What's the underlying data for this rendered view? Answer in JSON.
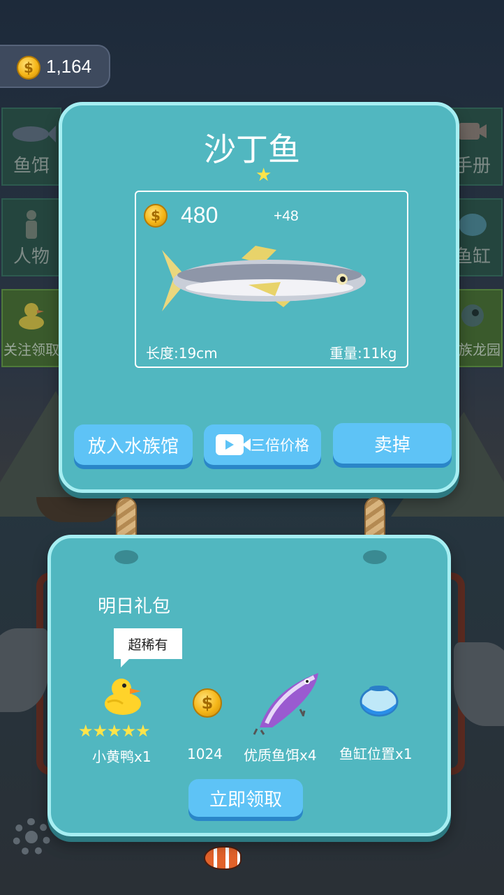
{
  "wallet": {
    "coins": "1,164"
  },
  "side_menu": {
    "left": [
      {
        "label": "鱼饵",
        "icon": "tuna-icon"
      },
      {
        "label": "人物",
        "icon": "person-icon"
      },
      {
        "label": "关注领取",
        "icon": "duck-icon"
      }
    ],
    "right": [
      {
        "label": "手册",
        "icon": "video-camera-icon"
      },
      {
        "label": "鱼缸",
        "icon": "fishbowl-icon"
      },
      {
        "label": "水族龙园",
        "icon": "fish-eye-icon"
      }
    ]
  },
  "catch": {
    "fish_name": "沙丁鱼",
    "rarity_stars": 1,
    "price": "480",
    "bonus": "+48",
    "length": "长度:19cm",
    "weight": "重量:11kg",
    "buttons": {
      "aquarium": "放入水族馆",
      "triple": "三倍价格",
      "sell": "卖掉"
    }
  },
  "gift": {
    "title": "明日礼包",
    "rare_tag": "超稀有",
    "rewards": [
      {
        "label": "小黄鸭x1",
        "stars": "★★★★★",
        "icon": "rubber-duck-icon"
      },
      {
        "label": "1024",
        "icon": "coin-icon"
      },
      {
        "label": "优质鱼饵x4",
        "icon": "fishing-lure-icon"
      },
      {
        "label": "鱼缸位置x1",
        "icon": "fishbowl-icon"
      }
    ],
    "claim_button": "立即领取"
  },
  "colors": {
    "panel": "#51b7c0",
    "panel_border": "#a6eef2",
    "button": "#5ec3f6",
    "star": "#ffe44a",
    "coin": "#f5b618"
  }
}
